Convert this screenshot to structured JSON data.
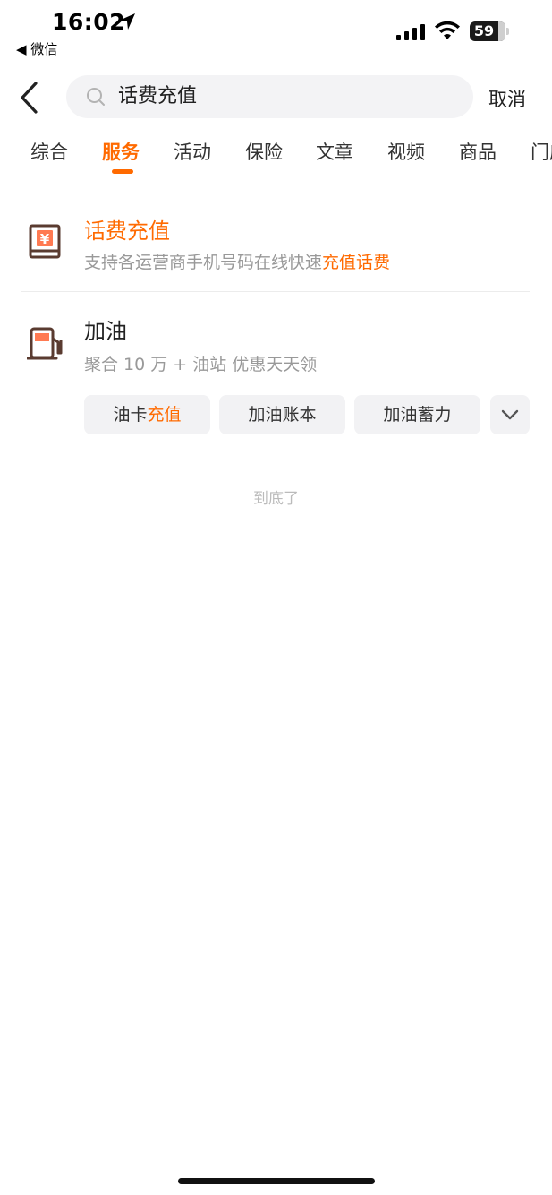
{
  "status_bar": {
    "time": "16:02",
    "back_app": "◀ 微信",
    "battery_percent": "59"
  },
  "search": {
    "query": "话费充值",
    "cancel_label": "取消"
  },
  "tabs": [
    {
      "label": "综合",
      "active": false
    },
    {
      "label": "服务",
      "active": true
    },
    {
      "label": "活动",
      "active": false
    },
    {
      "label": "保险",
      "active": false
    },
    {
      "label": "文章",
      "active": false
    },
    {
      "label": "视频",
      "active": false
    },
    {
      "label": "商品",
      "active": false
    },
    {
      "label": "门店",
      "active": false
    }
  ],
  "results": [
    {
      "title": "话费充值",
      "desc_plain": "支持各运营商手机号码在线快速",
      "desc_highlight": "充值话费",
      "icon": "yuan-book-icon"
    },
    {
      "title": "加油",
      "desc_plain": "聚合 10 万 + 油站 优惠天天领",
      "icon": "fuel-pump-icon",
      "chips": [
        {
          "plain": "油卡",
          "highlight": "充值"
        },
        {
          "plain": "加油账本",
          "highlight": ""
        },
        {
          "plain": "加油蓄力",
          "highlight": ""
        }
      ]
    }
  ],
  "footer_text": "到底了",
  "accent_color": "#ff6a00"
}
